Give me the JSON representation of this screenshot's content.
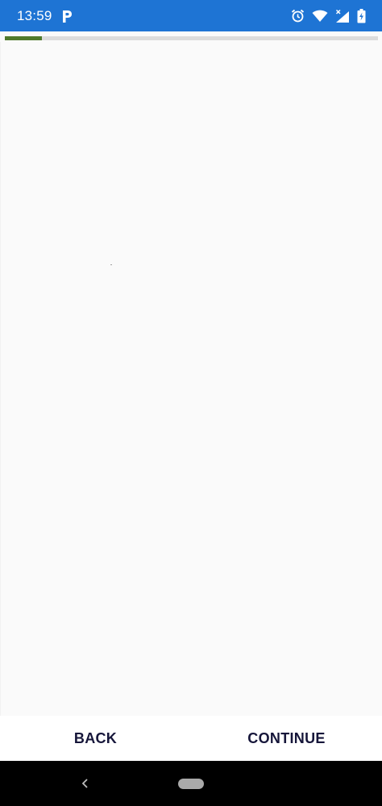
{
  "status_bar": {
    "time": "13:59",
    "app_icon": "parking-p-icon",
    "icons": [
      "alarm-icon",
      "wifi-icon",
      "signal-icon",
      "battery-charging-icon"
    ],
    "background_color": "#1e74d4"
  },
  "progress": {
    "value": 0.1,
    "fill_color": "#4f7a2c",
    "track_color": "#dcdcdc"
  },
  "actions": {
    "back_label": "BACK",
    "continue_label": "CONTINUE"
  },
  "nav_bar": {
    "icons": [
      "back-chevron-icon",
      "home-pill-icon"
    ]
  }
}
